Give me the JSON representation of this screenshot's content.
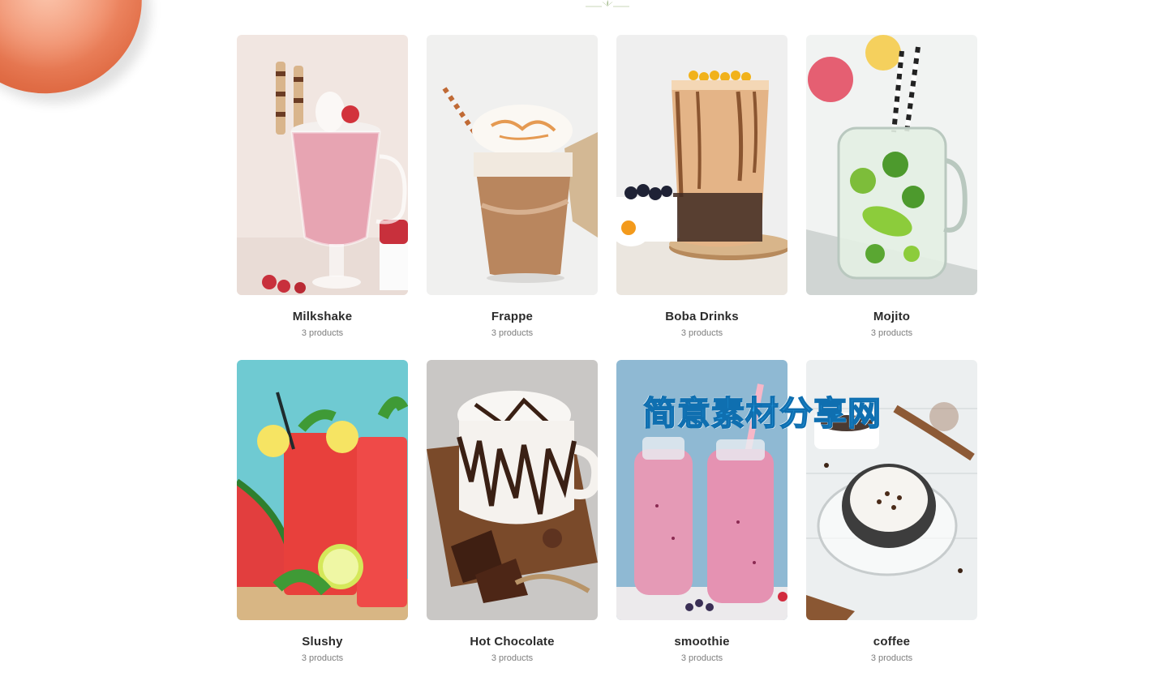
{
  "categories": [
    {
      "title": "Milkshake",
      "count": "3 products"
    },
    {
      "title": "Frappe",
      "count": "3 products"
    },
    {
      "title": "Boba Drinks",
      "count": "3 products"
    },
    {
      "title": "Mojito",
      "count": "3 products"
    },
    {
      "title": "Slushy",
      "count": "3 products"
    },
    {
      "title": "Hot Chocolate",
      "count": "3 products"
    },
    {
      "title": "smoothie",
      "count": "3 products"
    },
    {
      "title": "coffee",
      "count": "3 products"
    }
  ],
  "watermark": "简意素材分享网",
  "colors": {
    "title": "#2b2b2b",
    "subtitle": "#7d7d7d",
    "watermark": "#2ea3e8"
  }
}
